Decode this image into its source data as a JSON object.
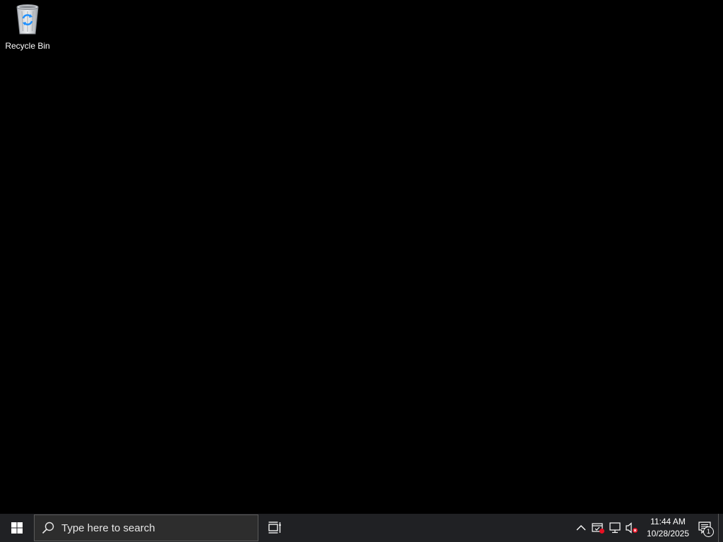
{
  "desktop": {
    "icons": [
      {
        "label": "Recycle Bin",
        "icon": "recycle-bin-icon"
      }
    ]
  },
  "taskbar": {
    "start_icon": "windows-logo-icon",
    "search": {
      "placeholder": "Type here to search",
      "icon": "search-icon"
    },
    "task_view_icon": "task-view-icon",
    "tray": {
      "show_hidden_icon": "chevron-up-icon",
      "icons": [
        "security-alert-icon",
        "network-disconnected-icon",
        "volume-muted-icon"
      ],
      "time": "11:44 AM",
      "date": "10/28/2025",
      "notification_count": "1"
    }
  },
  "colors": {
    "desktop_background": "#000000",
    "taskbar_background": "#202124",
    "search_background": "#2d2d2d",
    "alert_red": "#e81123",
    "accent_blue": "#1e90ff"
  }
}
